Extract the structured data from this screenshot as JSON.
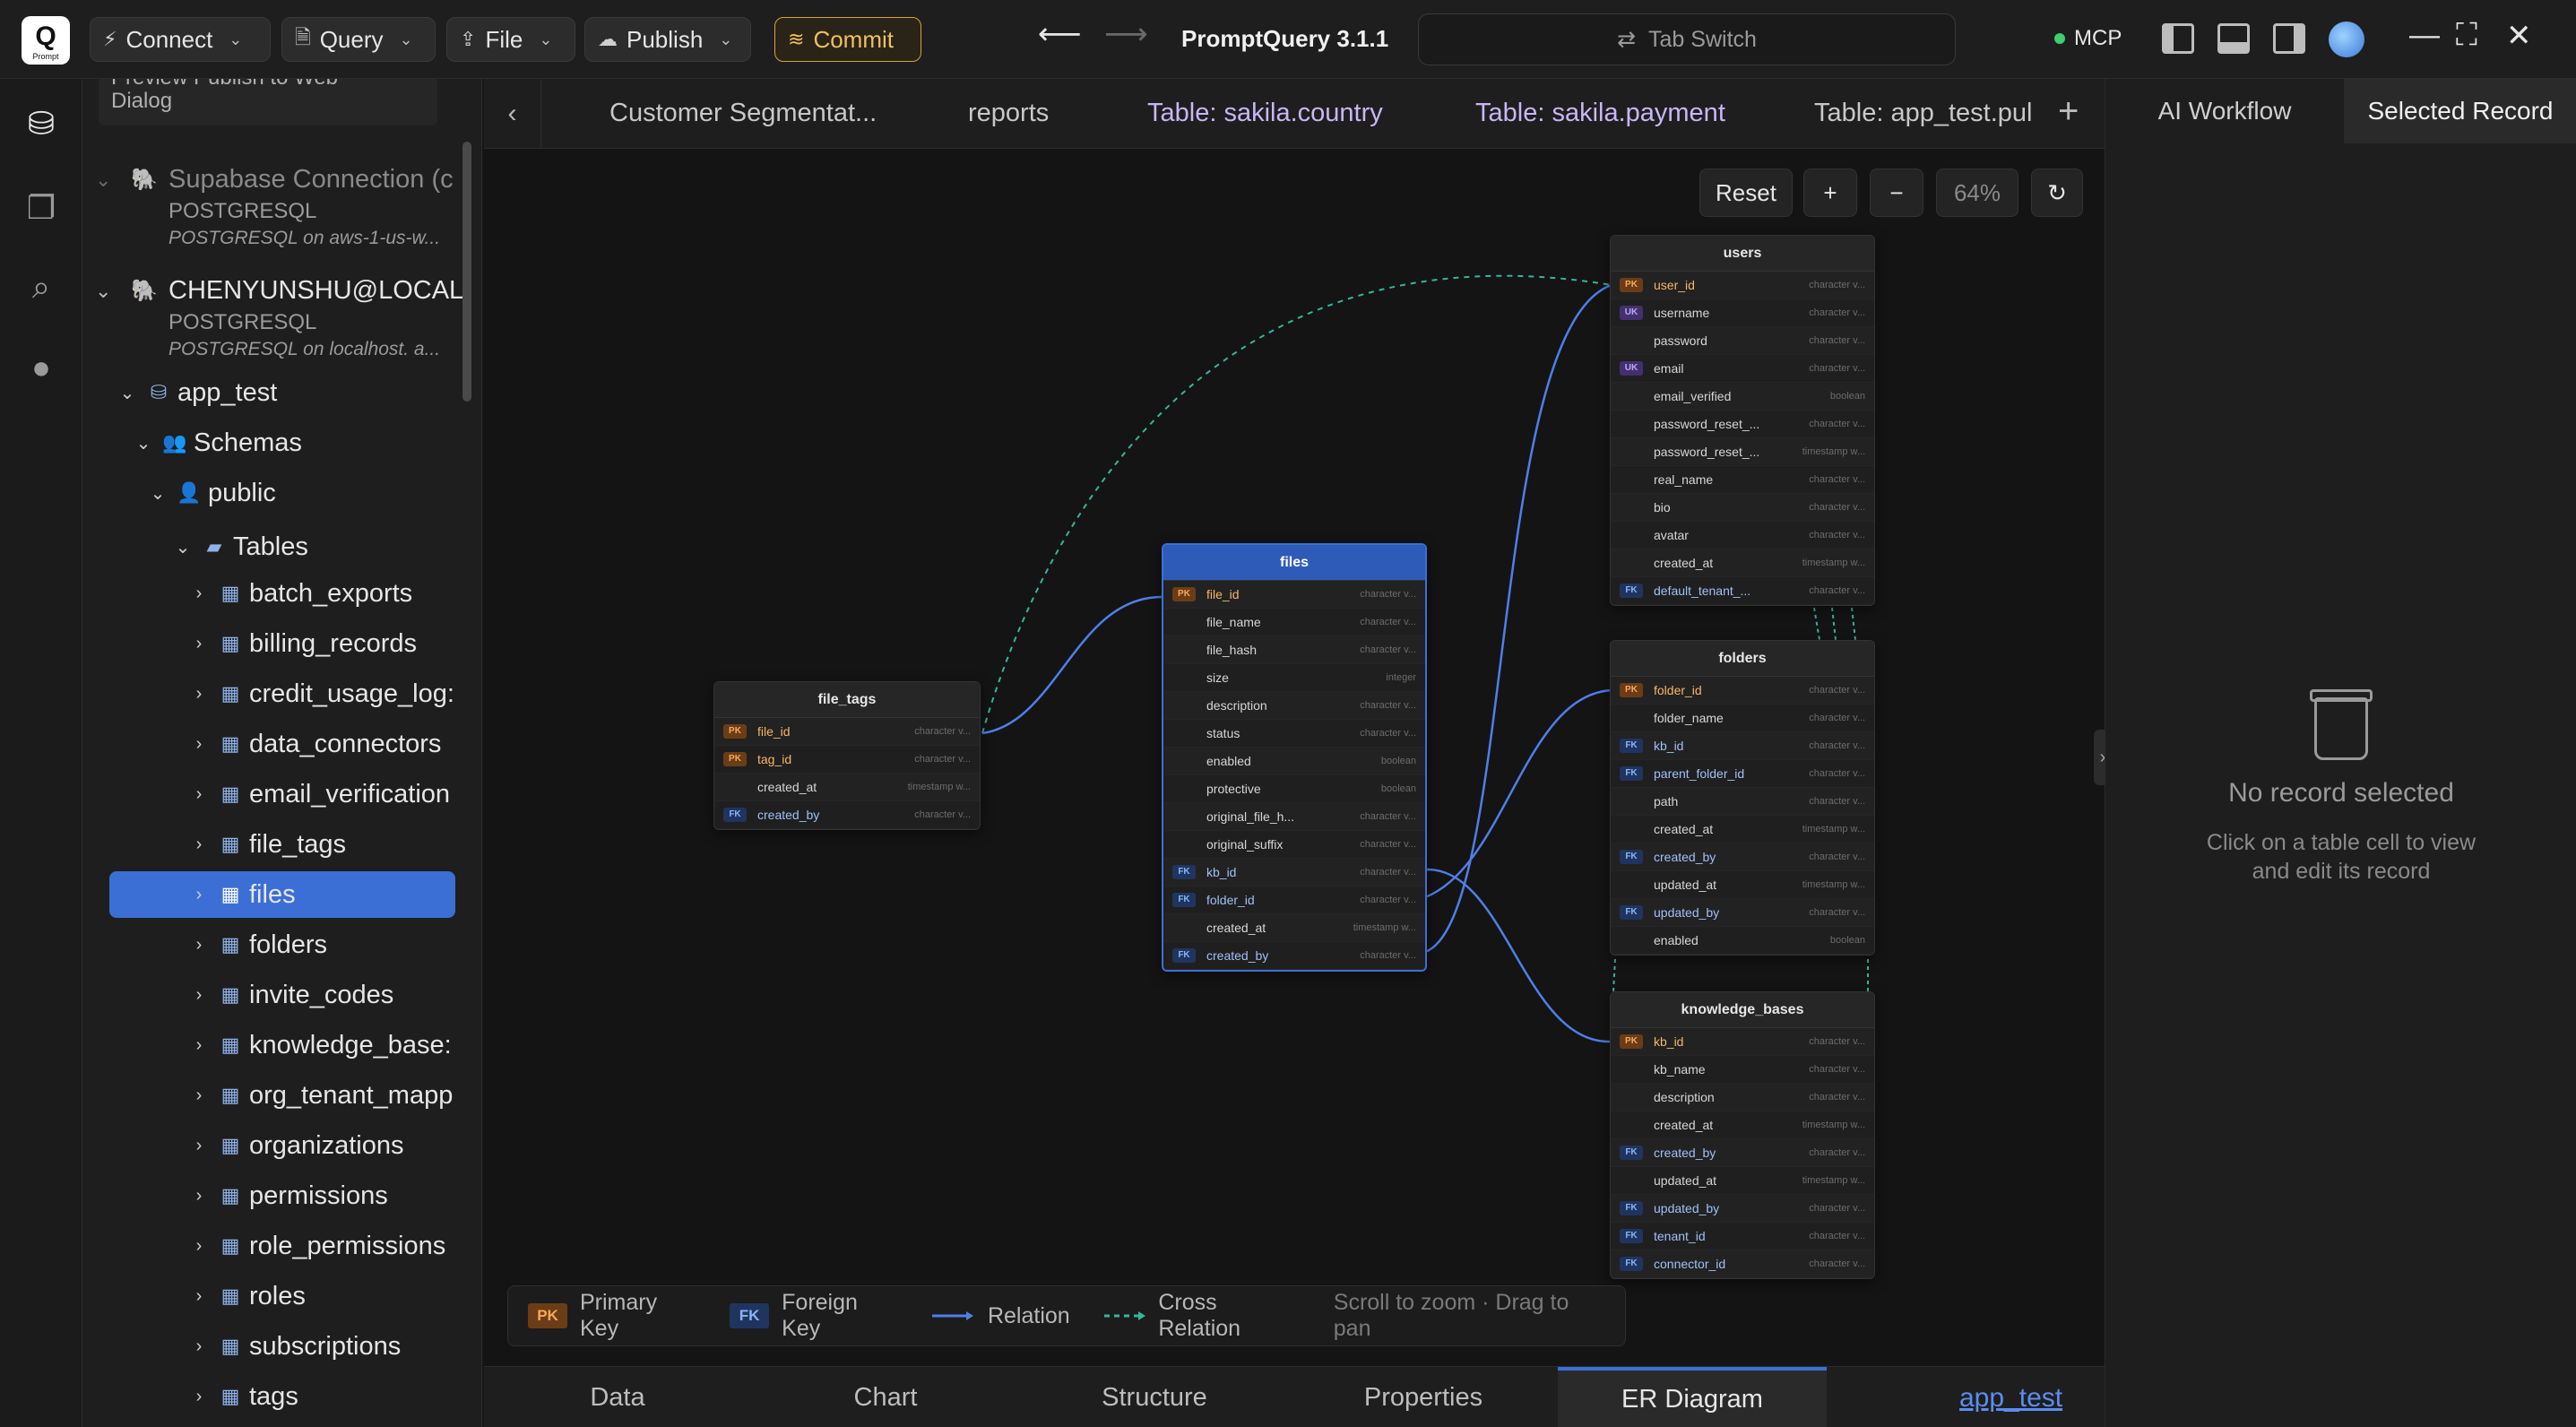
{
  "app": {
    "title": "PromptQuery 3.1.1",
    "logo_letter": "Q",
    "logo_sub": "Prompt"
  },
  "toolbar": {
    "connect": "Connect",
    "query": "Query",
    "file": "File",
    "publish": "Publish",
    "commit": "Commit",
    "tab_switch": "Tab Switch",
    "mcp": "MCP"
  },
  "sidebar": {
    "note_line1": "Preview Publish to Web",
    "note_line2": "Dialog",
    "connections": [
      {
        "name": "Supabase Connection (c",
        "type": "POSTGRESQL",
        "desc": "POSTGRESQL on aws-1-us-w..."
      },
      {
        "name": "CHENYUNSHU@LOCALI",
        "type": "POSTGRESQL",
        "desc": "POSTGRESQL on localhost. a..."
      }
    ],
    "database": "app_test",
    "schemas": "Schemas",
    "schema": "public",
    "tables_label": "Tables",
    "tables": [
      "batch_exports",
      "billing_records",
      "credit_usage_log:",
      "data_connectors",
      "email_verification",
      "file_tags",
      "files",
      "folders",
      "invite_codes",
      "knowledge_base:",
      "org_tenant_mapp",
      "organizations",
      "permissions",
      "role_permissions",
      "roles",
      "subscriptions",
      "tags"
    ]
  },
  "tabs": [
    "Customer Segmentat...",
    "reports",
    "Table: sakila.country",
    "Table: sakila.payment",
    "Table: app_test.pul"
  ],
  "zoom": {
    "reset": "Reset",
    "plus": "+",
    "minus": "−",
    "level": "64%"
  },
  "er": {
    "file_tags": {
      "title": "file_tags",
      "cols": [
        {
          "k": "pk",
          "n": "file_id",
          "t": "character v..."
        },
        {
          "k": "pk",
          "n": "tag_id",
          "t": "character v..."
        },
        {
          "k": "",
          "n": "created_at",
          "t": "timestamp w..."
        },
        {
          "k": "fk",
          "n": "created_by",
          "t": "character v..."
        }
      ]
    },
    "files": {
      "title": "files",
      "cols": [
        {
          "k": "pk",
          "n": "file_id",
          "t": "character v..."
        },
        {
          "k": "",
          "n": "file_name",
          "t": "character v..."
        },
        {
          "k": "",
          "n": "file_hash",
          "t": "character v..."
        },
        {
          "k": "",
          "n": "size",
          "t": "integer"
        },
        {
          "k": "",
          "n": "description",
          "t": "character v..."
        },
        {
          "k": "",
          "n": "status",
          "t": "character v..."
        },
        {
          "k": "",
          "n": "enabled",
          "t": "boolean"
        },
        {
          "k": "",
          "n": "protective",
          "t": "boolean"
        },
        {
          "k": "",
          "n": "original_file_h...",
          "t": "character v..."
        },
        {
          "k": "",
          "n": "original_suffix",
          "t": "character v..."
        },
        {
          "k": "fk",
          "n": "kb_id",
          "t": "character v..."
        },
        {
          "k": "fk",
          "n": "folder_id",
          "t": "character v..."
        },
        {
          "k": "",
          "n": "created_at",
          "t": "timestamp w..."
        },
        {
          "k": "fk",
          "n": "created_by",
          "t": "character v..."
        }
      ]
    },
    "users": {
      "title": "users",
      "cols": [
        {
          "k": "pk",
          "n": "user_id",
          "t": "character v..."
        },
        {
          "k": "uk",
          "n": "username",
          "t": "character v..."
        },
        {
          "k": "",
          "n": "password",
          "t": "character v..."
        },
        {
          "k": "uk",
          "n": "email",
          "t": "character v..."
        },
        {
          "k": "",
          "n": "email_verified",
          "t": "boolean"
        },
        {
          "k": "",
          "n": "password_reset_...",
          "t": "character v..."
        },
        {
          "k": "",
          "n": "password_reset_...",
          "t": "timestamp w..."
        },
        {
          "k": "",
          "n": "real_name",
          "t": "character v..."
        },
        {
          "k": "",
          "n": "bio",
          "t": "character v..."
        },
        {
          "k": "",
          "n": "avatar",
          "t": "character v..."
        },
        {
          "k": "",
          "n": "created_at",
          "t": "timestamp w..."
        },
        {
          "k": "fk",
          "n": "default_tenant_...",
          "t": "character v..."
        }
      ]
    },
    "folders": {
      "title": "folders",
      "cols": [
        {
          "k": "pk",
          "n": "folder_id",
          "t": "character v..."
        },
        {
          "k": "",
          "n": "folder_name",
          "t": "character v..."
        },
        {
          "k": "fk",
          "n": "kb_id",
          "t": "character v..."
        },
        {
          "k": "fk",
          "n": "parent_folder_id",
          "t": "character v..."
        },
        {
          "k": "",
          "n": "path",
          "t": "character v..."
        },
        {
          "k": "",
          "n": "created_at",
          "t": "timestamp w..."
        },
        {
          "k": "fk",
          "n": "created_by",
          "t": "character v..."
        },
        {
          "k": "",
          "n": "updated_at",
          "t": "timestamp w..."
        },
        {
          "k": "fk",
          "n": "updated_by",
          "t": "character v..."
        },
        {
          "k": "",
          "n": "enabled",
          "t": "boolean"
        }
      ]
    },
    "knowledge_bases": {
      "title": "knowledge_bases",
      "cols": [
        {
          "k": "pk",
          "n": "kb_id",
          "t": "character v..."
        },
        {
          "k": "",
          "n": "kb_name",
          "t": "character v..."
        },
        {
          "k": "",
          "n": "description",
          "t": "character v..."
        },
        {
          "k": "",
          "n": "created_at",
          "t": "timestamp w..."
        },
        {
          "k": "fk",
          "n": "created_by",
          "t": "character v..."
        },
        {
          "k": "",
          "n": "updated_at",
          "t": "timestamp w..."
        },
        {
          "k": "fk",
          "n": "updated_by",
          "t": "character v..."
        },
        {
          "k": "fk",
          "n": "tenant_id",
          "t": "character v..."
        },
        {
          "k": "fk",
          "n": "connector_id",
          "t": "character v..."
        }
      ]
    }
  },
  "legend": {
    "pk_badge": "PK",
    "pk": "Primary Key",
    "fk_badge": "FK",
    "fk": "Foreign Key",
    "relation": "Relation",
    "cross": "Cross Relation",
    "hint": "Scroll to zoom · Drag to pan"
  },
  "bottom_tabs": [
    "Data",
    "Chart",
    "Structure",
    "Properties",
    "ER Diagram"
  ],
  "db_link": "app_test",
  "right_panel": {
    "tabs": [
      "AI Workflow",
      "Selected Record"
    ],
    "empty_title": "No record selected",
    "empty_line1": "Click on a table cell to view",
    "empty_line2": "and edit its record"
  },
  "colors": {
    "accent": "#3b6fd6",
    "relation": "#4f7fe8",
    "cross_relation": "#35b69a",
    "pk": "#f6a85a",
    "fk": "#8cb4f5",
    "commit": "#f0c060"
  }
}
